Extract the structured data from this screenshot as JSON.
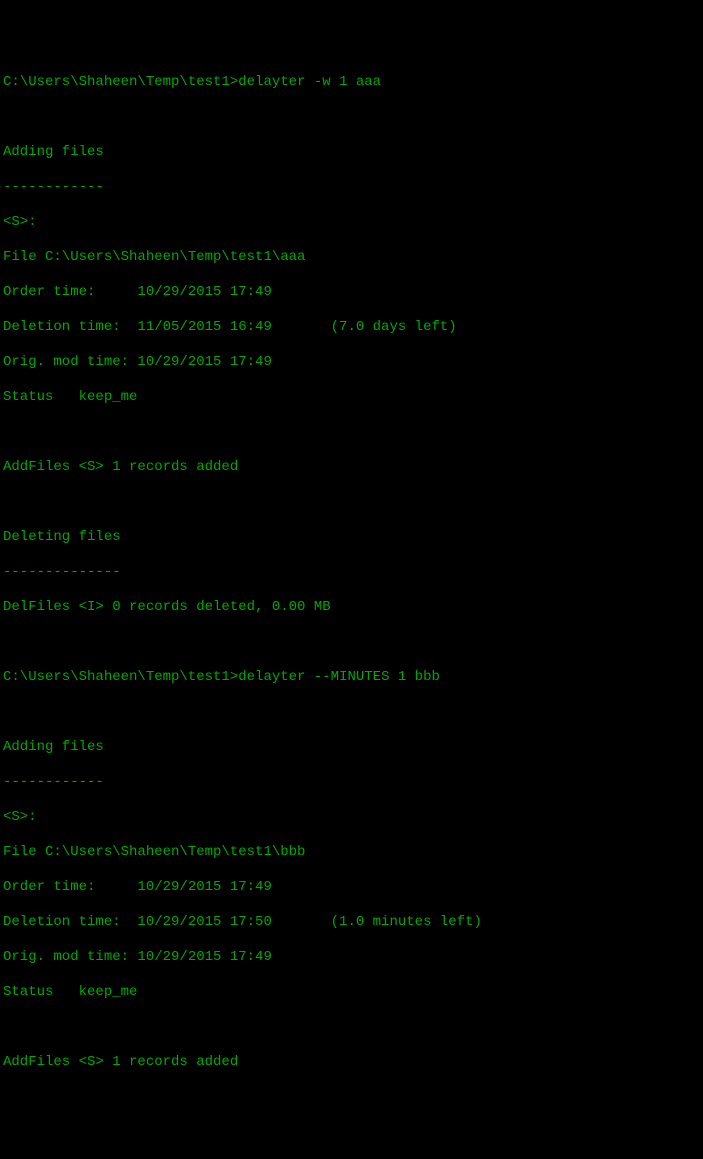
{
  "session1": {
    "prompt": "C:\\Users\\Shaheen\\Temp\\test1>",
    "command": "delayter -w 1 aaa",
    "adding_header": "Adding files",
    "divider": "------------",
    "id_line": "<S>:",
    "file_line": "File C:\\Users\\Shaheen\\Temp\\test1\\aaa",
    "order_time": "Order time:     10/29/2015 17:49",
    "deletion_time": "Deletion time:  11/05/2015 16:49       (7.0 days left)",
    "orig_mod": "Orig. mod time: 10/29/2015 17:49",
    "status": "Status   keep_me",
    "addfiles_result": "AddFiles <S> 1 records added",
    "deleting_header": "Deleting files",
    "deleting_divider": "--------------",
    "delfiles_result": "DelFiles <I> 0 records deleted, 0.00 MB"
  },
  "session2": {
    "prompt": "C:\\Users\\Shaheen\\Temp\\test1>",
    "command": "delayter --MINUTES 1 bbb",
    "adding_header": "Adding files",
    "divider": "------------",
    "id_line": "<S>:",
    "file_line": "File C:\\Users\\Shaheen\\Temp\\test1\\bbb",
    "order_time": "Order time:     10/29/2015 17:49",
    "deletion_time": "Deletion time:  10/29/2015 17:50       (1.0 minutes left)",
    "orig_mod": "Orig. mod time: 10/29/2015 17:49",
    "status": "Status   keep_me",
    "addfiles_result": "AddFiles <S> 1 records added"
  }
}
